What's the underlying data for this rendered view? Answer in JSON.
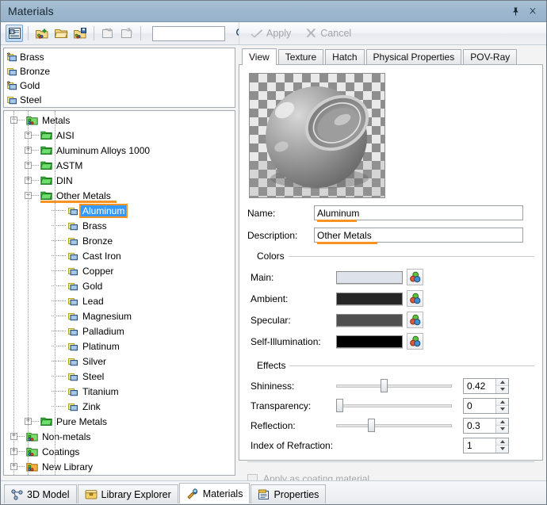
{
  "window": {
    "title": "Materials",
    "pin_icon": "pin-icon",
    "close_icon": "close-icon"
  },
  "toolbar": {
    "buttons": [
      {
        "name": "material-editor-button",
        "icon": "material-editor-icon",
        "active": true
      },
      {
        "name": "new-material-button",
        "icon": "new-material-icon",
        "active": false
      },
      {
        "name": "open-library-button",
        "icon": "open-folder-icon",
        "active": false
      },
      {
        "name": "save-library-button",
        "icon": "save-library-icon",
        "active": false
      },
      {
        "name": "copy-material-button",
        "icon": "copy-icon",
        "active": false
      },
      {
        "name": "paste-material-button",
        "icon": "paste-icon",
        "active": false
      }
    ],
    "search_value": "",
    "search_placeholder": "",
    "search_icon": "magnifier-icon",
    "apply_label": "Apply",
    "cancel_label": "Cancel",
    "apply_icon": "checkmark-icon",
    "cancel_icon": "x-mark-icon"
  },
  "recent_list": [
    {
      "label": "Brass",
      "icon": "material-unknown-icon"
    },
    {
      "label": "Bronze",
      "icon": "material-icon"
    },
    {
      "label": "Gold",
      "icon": "material-unknown-icon"
    },
    {
      "label": "Steel",
      "icon": "material-icon"
    }
  ],
  "tree": [
    {
      "label": "Metals",
      "depth": 0,
      "toggle": "minus",
      "icon": "library-icon",
      "selected": false,
      "underline": false
    },
    {
      "label": "AISI",
      "depth": 1,
      "toggle": "plus",
      "icon": "folder-icon",
      "selected": false,
      "underline": false
    },
    {
      "label": "Aluminum Alloys 1000",
      "depth": 1,
      "toggle": "plus",
      "icon": "folder-icon",
      "selected": false,
      "underline": false
    },
    {
      "label": "ASTM",
      "depth": 1,
      "toggle": "plus",
      "icon": "folder-icon",
      "selected": false,
      "underline": false
    },
    {
      "label": "DIN",
      "depth": 1,
      "toggle": "plus",
      "icon": "folder-icon",
      "selected": false,
      "underline": false
    },
    {
      "label": "Other Metals",
      "depth": 1,
      "toggle": "minus",
      "icon": "folder-icon",
      "selected": false,
      "underline": true
    },
    {
      "label": "Aluminum",
      "depth": 2,
      "toggle": "none",
      "icon": "material-icon",
      "selected": true,
      "underline": false
    },
    {
      "label": "Brass",
      "depth": 2,
      "toggle": "none",
      "icon": "material-icon",
      "selected": false,
      "underline": false
    },
    {
      "label": "Bronze",
      "depth": 2,
      "toggle": "none",
      "icon": "material-icon",
      "selected": false,
      "underline": false
    },
    {
      "label": "Cast Iron",
      "depth": 2,
      "toggle": "none",
      "icon": "material-icon",
      "selected": false,
      "underline": false
    },
    {
      "label": "Copper",
      "depth": 2,
      "toggle": "none",
      "icon": "material-icon",
      "selected": false,
      "underline": false
    },
    {
      "label": "Gold",
      "depth": 2,
      "toggle": "none",
      "icon": "material-icon",
      "selected": false,
      "underline": false
    },
    {
      "label": "Lead",
      "depth": 2,
      "toggle": "none",
      "icon": "material-icon",
      "selected": false,
      "underline": false
    },
    {
      "label": "Magnesium",
      "depth": 2,
      "toggle": "none",
      "icon": "material-icon",
      "selected": false,
      "underline": false
    },
    {
      "label": "Palladium",
      "depth": 2,
      "toggle": "none",
      "icon": "material-icon",
      "selected": false,
      "underline": false
    },
    {
      "label": "Platinum",
      "depth": 2,
      "toggle": "none",
      "icon": "material-icon",
      "selected": false,
      "underline": false
    },
    {
      "label": "Silver",
      "depth": 2,
      "toggle": "none",
      "icon": "material-icon",
      "selected": false,
      "underline": false
    },
    {
      "label": "Steel",
      "depth": 2,
      "toggle": "none",
      "icon": "material-icon",
      "selected": false,
      "underline": false
    },
    {
      "label": "Titanium",
      "depth": 2,
      "toggle": "none",
      "icon": "material-icon",
      "selected": false,
      "underline": false
    },
    {
      "label": "Zink",
      "depth": 2,
      "toggle": "none",
      "icon": "material-icon",
      "selected": false,
      "underline": false
    },
    {
      "label": "Pure Metals",
      "depth": 1,
      "toggle": "plus",
      "icon": "folder-icon",
      "selected": false,
      "underline": false
    },
    {
      "label": "Non-metals",
      "depth": 0,
      "toggle": "plus",
      "icon": "library-icon",
      "selected": false,
      "underline": false
    },
    {
      "label": "Coatings",
      "depth": 0,
      "toggle": "plus",
      "icon": "library-icon",
      "selected": false,
      "underline": false
    },
    {
      "label": "New Library",
      "depth": 0,
      "toggle": "plus",
      "icon": "library-new-icon",
      "selected": false,
      "underline": false
    }
  ],
  "tabs": [
    {
      "label": "View",
      "active": true
    },
    {
      "label": "Texture",
      "active": false
    },
    {
      "label": "Hatch",
      "active": false
    },
    {
      "label": "Physical Properties",
      "active": false
    },
    {
      "label": "POV-Ray",
      "active": false
    }
  ],
  "view": {
    "preview_name": "material-preview",
    "name_label": "Name:",
    "name_value": "Aluminum",
    "description_label": "Description:",
    "description_value": "Other Metals",
    "colors_group_label": "Colors",
    "colors": [
      {
        "label": "Main:",
        "value": "#dde2eb"
      },
      {
        "label": "Ambient:",
        "value": "#262626"
      },
      {
        "label": "Specular:",
        "value": "#4f4f4f"
      },
      {
        "label": "Self-Illumination:",
        "value": "#000000"
      }
    ],
    "color_picker_icon": "color-wheel-icon",
    "effects_group_label": "Effects",
    "effects": [
      {
        "label": "Shininess:",
        "value": "0.42",
        "slider": true,
        "pct": 42
      },
      {
        "label": "Transparency:",
        "value": "0",
        "slider": true,
        "pct": 0
      },
      {
        "label": "Reflection:",
        "value": "0.3",
        "slider": true,
        "pct": 30
      },
      {
        "label": "Index of Refraction:",
        "value": "1",
        "slider": false,
        "pct": 0
      }
    ],
    "coating_checkbox_label": "Apply as coating material",
    "coating_checked": false
  },
  "bottom_tabs": [
    {
      "label": "3D Model",
      "icon": "3d-model-icon",
      "active": false
    },
    {
      "label": "Library Explorer",
      "icon": "library-explorer-icon",
      "active": false
    },
    {
      "label": "Materials",
      "icon": "materials-icon",
      "active": true
    },
    {
      "label": "Properties",
      "icon": "properties-icon",
      "active": false
    }
  ],
  "colors": {
    "titlebar": "#9db7ce",
    "selection": "#3399ff",
    "accent_orange": "#f79321"
  }
}
